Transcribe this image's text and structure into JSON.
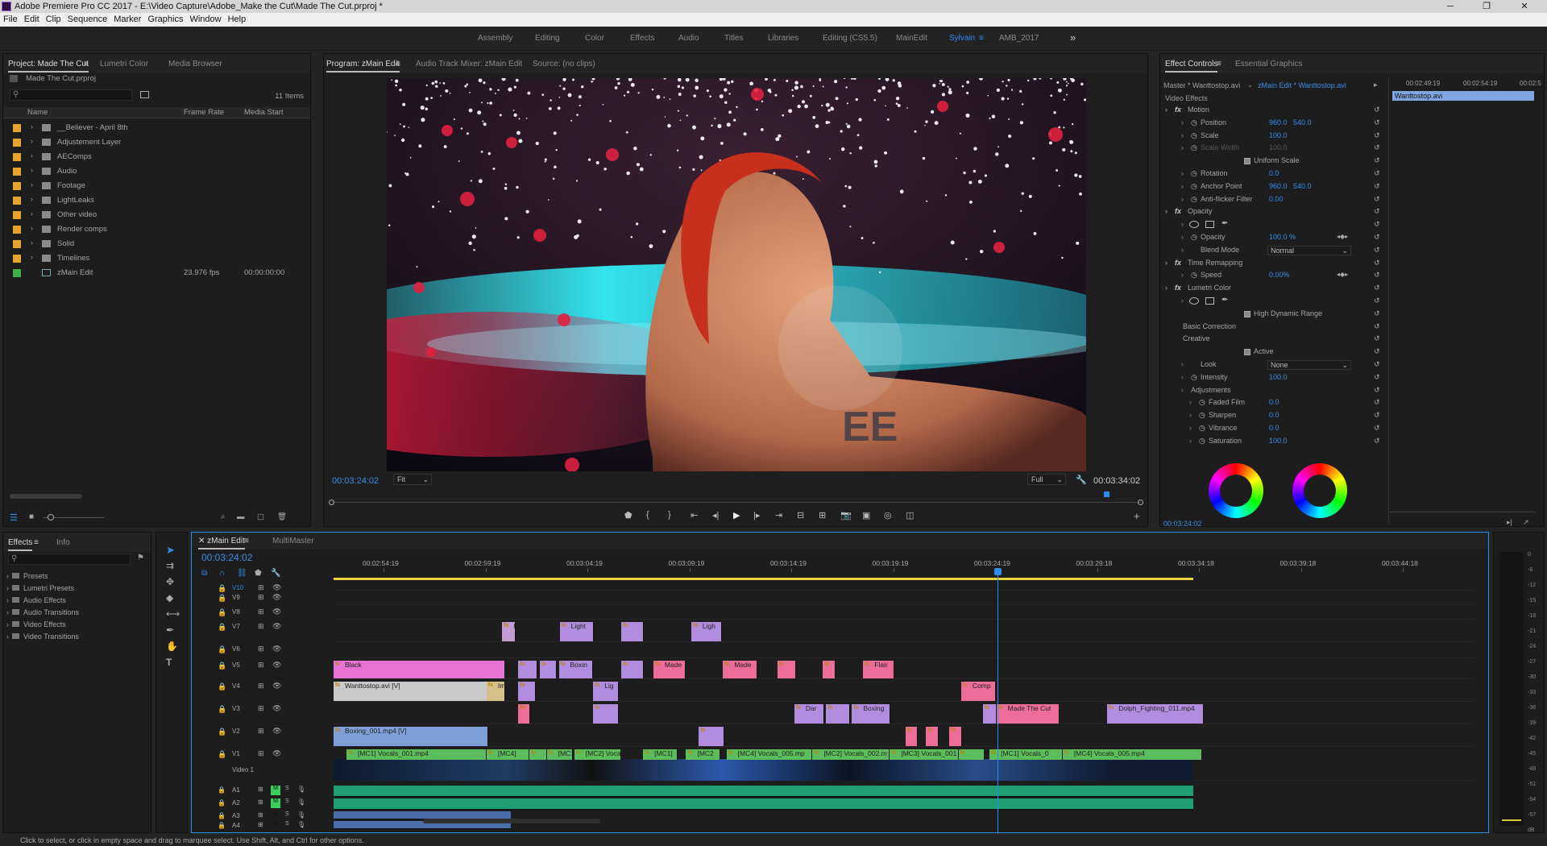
{
  "titlebar": {
    "title": "Adobe Premiere Pro CC 2017 - E:\\Video Capture\\Adobe_Make the Cut\\Made The Cut.prproj *",
    "min": "─",
    "max": "❐",
    "close": "✕"
  },
  "menu": [
    "File",
    "Edit",
    "Clip",
    "Sequence",
    "Marker",
    "Graphics",
    "Window",
    "Help"
  ],
  "workspaces": [
    "Assembly",
    "Editing",
    "Color",
    "Effects",
    "Audio",
    "Titles",
    "Libraries",
    "Editing (CS5.5)",
    "MainEdit",
    "Sylvain",
    "AMB_2017"
  ],
  "ws_more": "»",
  "project": {
    "tabs": [
      "Project: Made The Cut",
      "Lumetri Color",
      "Media Browser"
    ],
    "file": "Made The Cut.prproj",
    "count": "11 Items",
    "cols": [
      "Name",
      "Frame Rate",
      "Media Start"
    ],
    "items": [
      {
        "name": "__Believer - April 8th",
        "color": "#e8a32a"
      },
      {
        "name": "Adjustement Layer",
        "color": "#e8a32a"
      },
      {
        "name": "AEComps",
        "color": "#e8a32a"
      },
      {
        "name": "Audio",
        "color": "#e8a32a"
      },
      {
        "name": "Footage",
        "color": "#e8a32a"
      },
      {
        "name": "LightLeaks",
        "color": "#e8a32a"
      },
      {
        "name": "Other video",
        "color": "#e8a32a"
      },
      {
        "name": "Render comps",
        "color": "#e8a32a"
      },
      {
        "name": "Solid",
        "color": "#e8a32a"
      },
      {
        "name": "Timelines",
        "color": "#e8a32a"
      },
      {
        "name": "zMain Edit",
        "color": "#3db04a",
        "fps": "23.976 fps",
        "start": "00:00:00:00"
      }
    ]
  },
  "program": {
    "tabs": [
      "Program: zMain Edit",
      "Audio Track Mixer: zMain Edit",
      "Source: (no clips)"
    ],
    "timecode": "00:03:24:02",
    "fit": "Fit",
    "quality": "Full",
    "duration": "00:03:34:02"
  },
  "effects_ctrl": {
    "tabs": [
      "Effect Controls",
      "Essential Graphics"
    ],
    "master": "Master * Wanttostop.avi",
    "seq": "zMain Edit * Wanttostop.avi",
    "clip": "Wanttostop.avi",
    "ruler": [
      "00:02:49:19",
      "00:02:54:19",
      "00:02:5"
    ],
    "section": "Video Effects",
    "timecode": "00:03:24:02",
    "rows": [
      {
        "label": "Motion",
        "fx": true,
        "indent": 0
      },
      {
        "label": "Position",
        "v1": "960.0",
        "v2": "540.0",
        "indent": 2
      },
      {
        "label": "Scale",
        "v1": "100.0",
        "indent": 2
      },
      {
        "label": "Scale Width",
        "v1": "100.0",
        "indent": 2,
        "dim": true
      },
      {
        "label": "Uniform Scale",
        "check": true,
        "indent": 5
      },
      {
        "label": "Rotation",
        "v1": "0.0",
        "indent": 2
      },
      {
        "label": "Anchor Point",
        "v1": "960.0",
        "v2": "540.0",
        "indent": 2
      },
      {
        "label": "Anti-flicker Filter",
        "v1": "0.00",
        "indent": 2
      },
      {
        "label": "Opacity",
        "fx": true,
        "indent": 0
      },
      {
        "label": "",
        "shapes": true,
        "indent": 2
      },
      {
        "label": "Opacity",
        "v1": "100.0 %",
        "indent": 2
      },
      {
        "label": "Blend Mode",
        "dd": "Normal",
        "indent": 2
      },
      {
        "label": "Time Remapping",
        "fx": true,
        "indent": 0
      },
      {
        "label": "Speed",
        "v1": "0.00%",
        "indent": 2
      },
      {
        "label": "Lumetri Color",
        "fx": true,
        "indent": 0
      },
      {
        "label": "",
        "shapes": true,
        "indent": 2
      },
      {
        "label": "High Dynamic Range",
        "check": true,
        "indent": 5
      },
      {
        "label": "Basic Correction",
        "indent": 1
      },
      {
        "label": "Creative",
        "indent": 1
      },
      {
        "label": "Active",
        "check": true,
        "indent": 5
      },
      {
        "label": "Look",
        "dd": "None",
        "indent": 2
      },
      {
        "label": "Intensity",
        "v1": "100.0",
        "indent": 2
      },
      {
        "label": "Adjustments",
        "indent": 2
      },
      {
        "label": "Faded Film",
        "v1": "0.0",
        "indent": 3
      },
      {
        "label": "Sharpen",
        "v1": "0.0",
        "indent": 3
      },
      {
        "label": "Vibrance",
        "v1": "0.0",
        "indent": 3
      },
      {
        "label": "Saturation",
        "v1": "100.0",
        "indent": 3
      }
    ]
  },
  "effects_panel": {
    "tabs": [
      "Effects",
      "Info"
    ],
    "items": [
      "Presets",
      "Lumetri Presets",
      "Audio Effects",
      "Audio Transitions",
      "Video Effects",
      "Video Transitions"
    ]
  },
  "timeline": {
    "tabs": [
      "zMain Edit",
      "MultiMaster"
    ],
    "timecode": "00:03:24:02",
    "ruler": [
      "00:02:54:19",
      "00:02:59:19",
      "00:03:04:19",
      "00:03:09:19",
      "00:03:14:19",
      "00:03:19:19",
      "00:03:24:19",
      "00:03:29:18",
      "00:03:34:18",
      "00:03:39:18",
      "00:03:44:18"
    ],
    "vtracks": [
      "V10",
      "V9",
      "V8",
      "V7",
      "V6",
      "V5",
      "V4",
      "V3",
      "V2",
      "V1"
    ],
    "v1_name": "Video 1",
    "atracks": [
      "A1",
      "A2",
      "A3",
      "A4"
    ],
    "clips": [
      {
        "track": "V7",
        "x": 0.196,
        "w": 0.016,
        "color": "#c39bd3",
        "label": "Im"
      },
      {
        "track": "V7",
        "x": 0.263,
        "w": 0.04,
        "color": "#b28ddf",
        "label": "Light"
      },
      {
        "track": "V7",
        "x": 0.335,
        "w": 0.026,
        "color": "#b28ddf",
        "label": ""
      },
      {
        "track": "V7",
        "x": 0.416,
        "w": 0.036,
        "color": "#b28ddf",
        "label": "Ligh"
      },
      {
        "track": "V5",
        "x": 0,
        "w": 0.2,
        "color": "#e774d4",
        "label": "Black"
      },
      {
        "track": "V5",
        "x": 0.215,
        "w": 0.022,
        "color": "#b28ddf",
        "label": ""
      },
      {
        "track": "V5",
        "x": 0.24,
        "w": 0.02,
        "color": "#b28ddf",
        "label": ""
      },
      {
        "track": "V5",
        "x": 0.262,
        "w": 0.04,
        "color": "#b28ddf",
        "label": "Boxin"
      },
      {
        "track": "V5",
        "x": 0.335,
        "w": 0.026,
        "color": "#b28ddf",
        "label": ""
      },
      {
        "track": "V5",
        "x": 0.372,
        "w": 0.038,
        "color": "#ec6c9a",
        "label": "Made"
      },
      {
        "track": "V5",
        "x": 0.453,
        "w": 0.04,
        "color": "#ec6c9a",
        "label": "Made"
      },
      {
        "track": "V5",
        "x": 0.516,
        "w": 0.022,
        "color": "#ec6c9a",
        "label": ""
      },
      {
        "track": "V5",
        "x": 0.569,
        "w": 0.015,
        "color": "#ec6c9a",
        "label": ""
      },
      {
        "track": "V5",
        "x": 0.616,
        "w": 0.036,
        "color": "#ec6c9a",
        "label": "Flair"
      },
      {
        "track": "V4",
        "x": 0,
        "w": 0.2,
        "color": "#c9c9c9",
        "label": "Wanttostop.avi [V]"
      },
      {
        "track": "V4",
        "x": 0.178,
        "w": 0.022,
        "color": "#d5c08a",
        "label": "Impa"
      },
      {
        "track": "V4",
        "x": 0.215,
        "w": 0.02,
        "color": "#b28ddf",
        "label": ""
      },
      {
        "track": "V4",
        "x": 0.302,
        "w": 0.03,
        "color": "#b28ddf",
        "label": "Lig"
      },
      {
        "track": "V4",
        "x": 0.73,
        "w": 0.04,
        "color": "#ec6c9a",
        "label": "Comp"
      },
      {
        "track": "V3",
        "x": 0.215,
        "w": 0.012,
        "color": "#ec6c9a",
        "label": ""
      },
      {
        "track": "V3",
        "x": 0.302,
        "w": 0.03,
        "color": "#b28ddf",
        "label": ""
      },
      {
        "track": "V3",
        "x": 0.536,
        "w": 0.035,
        "color": "#b28ddf",
        "label": "Dar"
      },
      {
        "track": "V3",
        "x": 0.573,
        "w": 0.028,
        "color": "#b28ddf",
        "label": ""
      },
      {
        "track": "V3",
        "x": 0.603,
        "w": 0.045,
        "color": "#b28ddf",
        "label": "Boxing"
      },
      {
        "track": "V3",
        "x": 0.755,
        "w": 0.016,
        "color": "#b28ddf",
        "label": ""
      },
      {
        "track": "V3",
        "x": 0.771,
        "w": 0.073,
        "color": "#ec6c9a",
        "label": "Made The Cut"
      },
      {
        "track": "V3",
        "x": 0.9,
        "w": 0.112,
        "color": "#b28ddf",
        "label": "Dolph_Fighting_011.mp4"
      },
      {
        "track": "V2",
        "x": 0,
        "w": 0.18,
        "color": "#7f9fd9",
        "label": "Boxing_001.mp4 [V]"
      },
      {
        "track": "V2",
        "x": 0.425,
        "w": 0.03,
        "color": "#b28ddf",
        "label": ""
      },
      {
        "track": "V2",
        "x": 0.665,
        "w": 0.012,
        "color": "#ec6c9a",
        "label": ""
      },
      {
        "track": "V2",
        "x": 0.689,
        "w": 0.015,
        "color": "#ec6c9a",
        "label": ""
      },
      {
        "track": "V2",
        "x": 0.716,
        "w": 0.015,
        "color": "#ec6c9a",
        "label": ""
      },
      {
        "track": "V1",
        "x": 0.015,
        "w": 0.163,
        "color": "#5bbd5b",
        "label": "[MC1] Vocals_001.mp4"
      },
      {
        "track": "V1",
        "x": 0.178,
        "w": 0.05,
        "color": "#5bbd5b",
        "label": "[MC4]"
      },
      {
        "track": "V1",
        "x": 0.228,
        "w": 0.02,
        "color": "#5bbd5b",
        "label": ""
      },
      {
        "track": "V1",
        "x": 0.248,
        "w": 0.03,
        "color": "#5bbd5b",
        "label": "[MC1]"
      },
      {
        "track": "V1",
        "x": 0.28,
        "w": 0.055,
        "color": "#5bbd5b",
        "label": "[MC2] Vocals"
      },
      {
        "track": "V1",
        "x": 0.36,
        "w": 0.04,
        "color": "#5bbd5b",
        "label": "[MC1]"
      },
      {
        "track": "V1",
        "x": 0.41,
        "w": 0.04,
        "color": "#5bbd5b",
        "label": "[MC2"
      },
      {
        "track": "V1",
        "x": 0.457,
        "w": 0.1,
        "color": "#5bbd5b",
        "label": "[MC4] Vocals_005.mp"
      },
      {
        "track": "V1",
        "x": 0.557,
        "w": 0.09,
        "color": "#5bbd5b",
        "label": "[MC2] Vocals_002.m"
      },
      {
        "track": "V1",
        "x": 0.647,
        "w": 0.08,
        "color": "#5bbd5b",
        "label": "[MC3] Vocals_001"
      },
      {
        "track": "V1",
        "x": 0.727,
        "w": 0.03,
        "color": "#5bbd5b",
        "label": ""
      },
      {
        "track": "V1",
        "x": 0.763,
        "w": 0.085,
        "color": "#5bbd5b",
        "label": "[MC1] Vocals_0"
      },
      {
        "track": "V1",
        "x": 0.848,
        "w": 0.162,
        "color": "#5bbd5b",
        "label": "[MC4] Vocals_005.mp4"
      }
    ]
  },
  "status": "Click to select, or click in empty space and drag to marquee select. Use Shift, Alt, and Ctrl for other options.",
  "meter_db": [
    "0",
    "-6",
    "-12",
    "-15",
    "-18",
    "-21",
    "-24",
    "-27",
    "-30",
    "-33",
    "-36",
    "-39",
    "-42",
    "-45",
    "-48",
    "-51",
    "-54",
    "-57",
    "dB"
  ],
  "colors": {
    "accent": "#2d8ceb",
    "playhead": "#3a8ee6",
    "folder": "#e8a32a",
    "sequence": "#3db04a"
  }
}
